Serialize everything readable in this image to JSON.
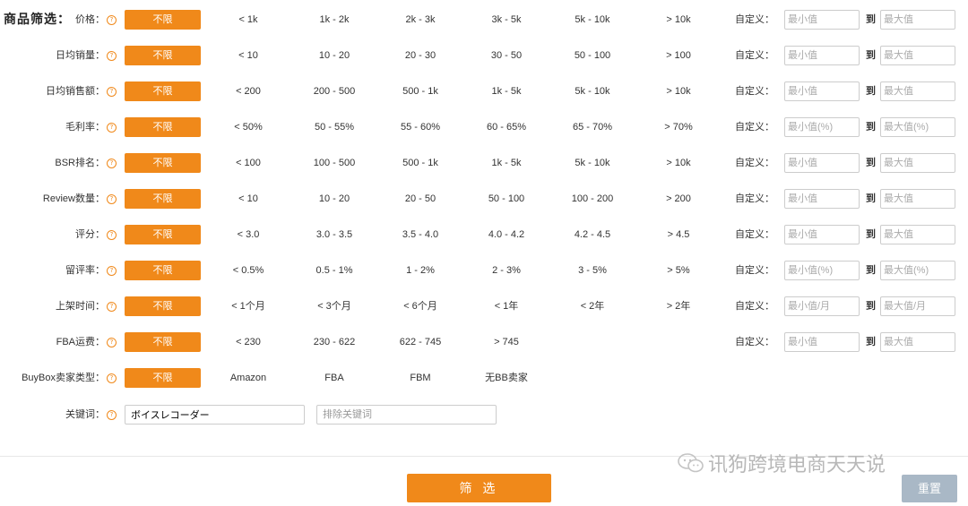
{
  "section_title": "商品筛选：",
  "all_label": "不限",
  "custom_label": "自定义：",
  "to_label": "到",
  "help_glyph": "?",
  "rows": [
    {
      "label": "价格：",
      "options": [
        "< 1k",
        "1k - 2k",
        "2k - 3k",
        "3k - 5k",
        "5k - 10k",
        "> 10k"
      ],
      "min_ph": "最小值",
      "max_ph": "最大值"
    },
    {
      "label": "日均销量：",
      "options": [
        "< 10",
        "10 - 20",
        "20 - 30",
        "30 - 50",
        "50 - 100",
        "> 100"
      ],
      "min_ph": "最小值",
      "max_ph": "最大值"
    },
    {
      "label": "日均销售额：",
      "options": [
        "< 200",
        "200 - 500",
        "500 - 1k",
        "1k - 5k",
        "5k - 10k",
        "> 10k"
      ],
      "min_ph": "最小值",
      "max_ph": "最大值"
    },
    {
      "label": "毛利率：",
      "options": [
        "< 50%",
        "50 - 55%",
        "55 - 60%",
        "60 - 65%",
        "65 - 70%",
        "> 70%"
      ],
      "min_ph": "最小值(%)",
      "max_ph": "最大值(%)"
    },
    {
      "label": "BSR排名：",
      "options": [
        "< 100",
        "100 - 500",
        "500 - 1k",
        "1k - 5k",
        "5k - 10k",
        "> 10k"
      ],
      "min_ph": "最小值",
      "max_ph": "最大值"
    },
    {
      "label": "Review数量：",
      "options": [
        "< 10",
        "10 - 20",
        "20 - 50",
        "50 - 100",
        "100 - 200",
        "> 200"
      ],
      "min_ph": "最小值",
      "max_ph": "最大值"
    },
    {
      "label": "评分：",
      "options": [
        "< 3.0",
        "3.0 - 3.5",
        "3.5 - 4.0",
        "4.0 - 4.2",
        "4.2 - 4.5",
        "> 4.5"
      ],
      "min_ph": "最小值",
      "max_ph": "最大值"
    },
    {
      "label": "留评率：",
      "options": [
        "< 0.5%",
        "0.5 - 1%",
        "1 - 2%",
        "2 - 3%",
        "3 - 5%",
        "> 5%"
      ],
      "min_ph": "最小值(%)",
      "max_ph": "最大值(%)"
    },
    {
      "label": "上架时间：",
      "options": [
        "< 1个月",
        "< 3个月",
        "< 6个月",
        "< 1年",
        "< 2年",
        "> 2年"
      ],
      "min_ph": "最小值/月",
      "max_ph": "最大值/月"
    },
    {
      "label": "FBA运费：",
      "options": [
        "< 230",
        "230 - 622",
        "622 - 745",
        "> 745"
      ],
      "min_ph": "最小值",
      "max_ph": "最大值"
    },
    {
      "label": "BuyBox卖家类型：",
      "options": [
        "Amazon",
        "FBA",
        "FBM",
        "无BB卖家"
      ]
    }
  ],
  "keyword": {
    "label": "关键词：",
    "include_value": "ボイスレコーダー",
    "exclude_placeholder": "排除关键词"
  },
  "filter_button": "筛 选",
  "reset_button": "重置",
  "watermark": "讯狗跨境电商天天说"
}
